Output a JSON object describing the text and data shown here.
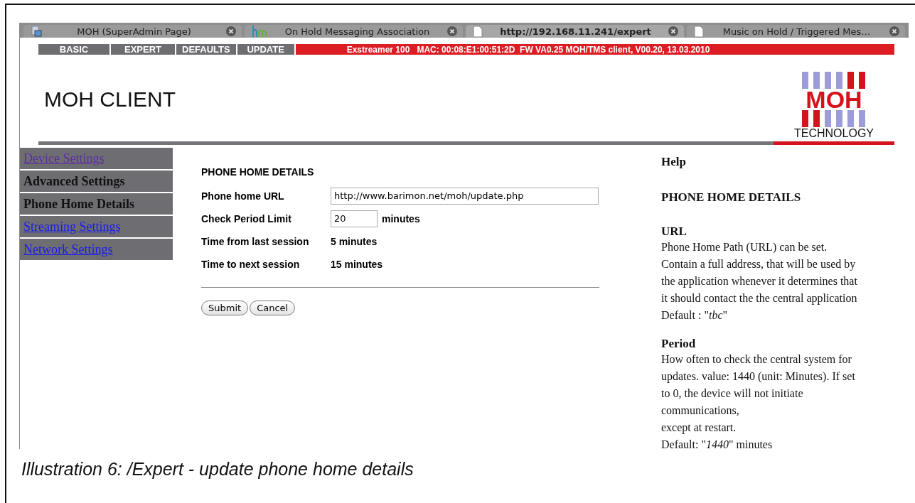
{
  "browser_tabs": [
    {
      "kind": "folder",
      "title": "MOH (SuperAdmin Page)",
      "selected": false
    },
    {
      "kind": "hm",
      "title": "On Hold Messaging Association",
      "selected": false
    },
    {
      "kind": "page",
      "title": "http://192.168.11.241/expert",
      "selected": true
    },
    {
      "kind": "page",
      "title": "Music on Hold / Triggered Mes…",
      "selected": false
    }
  ],
  "nav": [
    {
      "label": "BASIC"
    },
    {
      "label": "EXPERT"
    },
    {
      "label": "DEFAULTS"
    },
    {
      "label": "UPDATE"
    }
  ],
  "device_info": "Exstreamer 100   MAC: 00:08:E1:00:51:2D  FW VA0.25 MOH/TMS client, V00.20, 13.03.2010",
  "page_title": "MOH CLIENT",
  "logo": {
    "name": "MOH",
    "tagline": "TECHNOLOGY"
  },
  "sidebar": [
    {
      "label": "Device Settings",
      "kind": "visited"
    },
    {
      "label": "Advanced Settings",
      "kind": "heading"
    },
    {
      "label": "Phone Home Details",
      "kind": "heading"
    },
    {
      "label": "Streaming Settings",
      "kind": "link"
    },
    {
      "label": "Network Settings",
      "kind": "link"
    }
  ],
  "form": {
    "title": "PHONE HOME DETAILS",
    "rows": [
      {
        "kind": "input",
        "label": "Phone home URL",
        "value": "http://www.barimon.net/moh/update.php"
      },
      {
        "kind": "input",
        "label": "Check Period Limit",
        "value": "20",
        "unit": "minutes"
      },
      {
        "kind": "text",
        "label": "Time from last session",
        "value": "5 minutes"
      },
      {
        "kind": "text",
        "label": "Time to next session",
        "value": "15 minutes"
      }
    ],
    "buttons": [
      "Submit",
      "Cancel"
    ]
  },
  "help": {
    "title": "Help",
    "heading": "PHONE HOME DETAILS",
    "sections": [
      {
        "heading": "URL",
        "text": "Phone Home Path (URL) can be set.\nContain a full address, that will be used by\nthe application whenever it determines that\nit should contact the the central application\nDefault : \"*tbc*\""
      },
      {
        "heading": "Period",
        "text": "How often to check the central system for\nupdates. value: 1440 (unit: Minutes). If set\nto 0, the device will not initiate\ncommunications,\nexcept at restart.\nDefault: \"*1440*\" minutes"
      }
    ]
  },
  "caption": "Illustration 6: /Expert - update phone home details"
}
